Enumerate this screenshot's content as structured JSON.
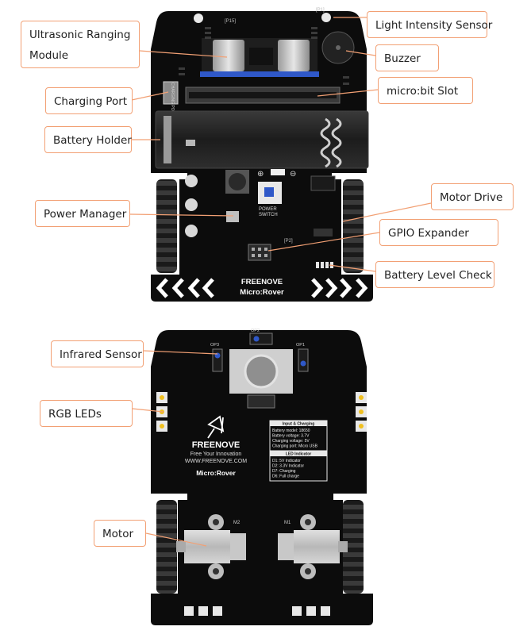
{
  "top_view": {
    "callouts": {
      "ultrasonic": "Ultrasonic Ranging Module",
      "light_sensor": "Light Intensity Sensor",
      "buzzer": "Buzzer",
      "charging_port": "Charging Port",
      "microbit_slot": "micro:bit Slot",
      "battery_holder": "Battery Holder",
      "motor_drive": "Motor Drive",
      "power_manager": "Power Manager",
      "gpio_expander": "GPIO Expander",
      "battery_level": "Battery Level Check"
    },
    "board_labels": {
      "brand": "FREENOVE",
      "model": "Micro:Rover",
      "power_switch_1": "POWER",
      "power_switch_2": "SWITCH",
      "charging_side": "CHARGING PORT",
      "p15": "[P15]",
      "p1": "[P1]",
      "p2": "[P2]",
      "plus": "⊕",
      "minus": "⊖"
    }
  },
  "bottom_view": {
    "callouts": {
      "infrared": "Infrared Sensor",
      "rgb_leds": "RGB LEDs",
      "motor": "Motor"
    },
    "board_labels": {
      "brand": "FREENOVE",
      "tagline": "Free Your Innovation",
      "website": "WWW.FREENOVE.COM",
      "model": "Micro:Rover",
      "info_title": "Input & Charging",
      "info_lines": [
        "Battery model: 18650",
        "Battery voltage: 3.7V",
        "Charging voltage: 5V",
        "Charging port: Micro USB"
      ],
      "led_title": "LED Indicator",
      "led_lines": [
        "D1: 5V Indicator",
        "D2: 3.3V Indicator",
        "D7: Charging",
        "D6: Full charge"
      ],
      "m1": "M1",
      "m2": "M2",
      "op1": "OP1",
      "op2": "OP2",
      "op3": "OP3"
    }
  },
  "colors": {
    "callout_border": "#f2a074",
    "leader_line": "#f2a074",
    "pcb": "#0c0c0c",
    "track": "#2a2a2a",
    "motor": "#c8c8c8",
    "accent_blue": "#2f58c8"
  }
}
